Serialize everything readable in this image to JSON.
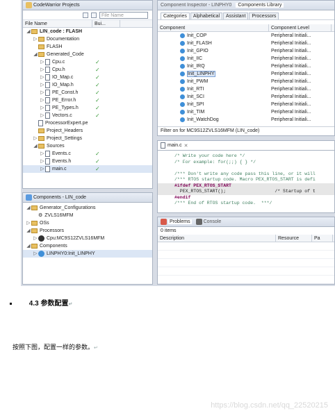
{
  "project_explorer": {
    "tab_title": "CodeWarrior Projects",
    "filter_placeholder": "File Name",
    "col_name": "File Name",
    "col_build": "Bui...",
    "rows": [
      {
        "indent": 0,
        "twisty": "◢",
        "icon": "folder",
        "label": "LIN_code : FLASH",
        "bold": true,
        "check": false
      },
      {
        "indent": 1,
        "twisty": "▷",
        "icon": "folder",
        "label": "Documentation",
        "check": false
      },
      {
        "indent": 1,
        "twisty": "",
        "icon": "folder",
        "label": "FLASH",
        "check": false
      },
      {
        "indent": 1,
        "twisty": "◢",
        "icon": "folder",
        "label": "Generated_Code",
        "check": false
      },
      {
        "indent": 2,
        "twisty": "▷",
        "icon": "file",
        "label": "Cpu.c",
        "check": true
      },
      {
        "indent": 2,
        "twisty": "▷",
        "icon": "file",
        "label": "Cpu.h",
        "check": true
      },
      {
        "indent": 2,
        "twisty": "▷",
        "icon": "file",
        "label": "IO_Map.c",
        "check": true
      },
      {
        "indent": 2,
        "twisty": "▷",
        "icon": "file",
        "label": "IO_Map.h",
        "check": true
      },
      {
        "indent": 2,
        "twisty": "▷",
        "icon": "file",
        "label": "PE_Const.h",
        "check": true
      },
      {
        "indent": 2,
        "twisty": "▷",
        "icon": "file",
        "label": "PE_Error.h",
        "check": true
      },
      {
        "indent": 2,
        "twisty": "▷",
        "icon": "file",
        "label": "PE_Types.h",
        "check": true
      },
      {
        "indent": 2,
        "twisty": "▷",
        "icon": "file",
        "label": "Vectors.c",
        "check": true
      },
      {
        "indent": 1,
        "twisty": "",
        "icon": "file",
        "label": "ProcessorExpert.pe",
        "check": false
      },
      {
        "indent": 1,
        "twisty": "",
        "icon": "folder",
        "label": "Project_Headers",
        "check": false
      },
      {
        "indent": 1,
        "twisty": "▷",
        "icon": "folder",
        "label": "Project_Settings",
        "check": false
      },
      {
        "indent": 1,
        "twisty": "◢",
        "icon": "folder",
        "label": "Sources",
        "check": false
      },
      {
        "indent": 2,
        "twisty": "▷",
        "icon": "file",
        "label": "Events.c",
        "check": true
      },
      {
        "indent": 2,
        "twisty": "▷",
        "icon": "file",
        "label": "Events.h",
        "check": true
      },
      {
        "indent": 2,
        "twisty": "▷",
        "icon": "file",
        "label": "main.c",
        "check": true,
        "selected": true
      }
    ]
  },
  "components_view": {
    "tab_title": "Components - LIN_code",
    "rows": [
      {
        "indent": 0,
        "twisty": "◢",
        "icon": "folder",
        "label": "Generator_Configurations"
      },
      {
        "indent": 1,
        "twisty": "",
        "icon": "gear",
        "label": "ZVLS16MFM"
      },
      {
        "indent": 0,
        "twisty": "▷",
        "icon": "folder",
        "label": "OSs"
      },
      {
        "indent": 0,
        "twisty": "◢",
        "icon": "folder",
        "label": "Processors"
      },
      {
        "indent": 1,
        "twisty": "▷",
        "icon": "chip",
        "label": "Cpu:MC9S12ZVLS16MFM"
      },
      {
        "indent": 0,
        "twisty": "◢",
        "icon": "folder",
        "label": "Components"
      },
      {
        "indent": 1,
        "twisty": "▷",
        "icon": "bean",
        "label": "LINPHY0:Init_LINPHY",
        "selected": true
      }
    ]
  },
  "inspector": {
    "tab1": "Component Inspector - LINPHY0",
    "tab2": "Components Library",
    "subtabs": [
      "Categories",
      "Alphabetical",
      "Assistant",
      "Processors"
    ],
    "col_component": "Component",
    "col_level": "Component Level",
    "rows": [
      {
        "name": "Init_COP",
        "level": "Peripheral Initiali..."
      },
      {
        "name": "Init_FLASH",
        "level": "Peripheral Initiali..."
      },
      {
        "name": "Init_GPIO",
        "level": "Peripheral Initiali..."
      },
      {
        "name": "Init_IIC",
        "level": "Peripheral Initiali..."
      },
      {
        "name": "Init_IRQ",
        "level": "Peripheral Initiali..."
      },
      {
        "name": "Init_LINPHY",
        "level": "Peripheral Initiali...",
        "selected": true
      },
      {
        "name": "Init_PWM",
        "level": "Peripheral Initiali..."
      },
      {
        "name": "Init_RTI",
        "level": "Peripheral Initiali..."
      },
      {
        "name": "Init_SCI",
        "level": "Peripheral Initiali..."
      },
      {
        "name": "Init_SPI",
        "level": "Peripheral Initiali..."
      },
      {
        "name": "Init_TIM",
        "level": "Peripheral Initiali..."
      },
      {
        "name": "Init_WatchDog",
        "level": "Peripheral Initiali..."
      }
    ],
    "filter_text": "Filter on for MC9S12ZVLS16MFM (LIN_code)"
  },
  "editor": {
    "tab": "main.c",
    "lines": [
      {
        "cls": "cm",
        "text": "/* Write your code here */"
      },
      {
        "cls": "cm",
        "text": "/* For example: for(;;) { } */"
      },
      {
        "cls": "",
        "text": ""
      },
      {
        "cls": "cm",
        "text": "/*** Don't write any code pass this line, or it will"
      },
      {
        "cls": "cm",
        "text": "/*** RTOS startup code. Macro PEX_RTOS_START is defi"
      },
      {
        "cls": "pp hl",
        "text": "#ifdef PEX_RTOS_START"
      },
      {
        "cls": "hl",
        "text": "  PEX_RTOS_START();                  /* Startup of t"
      },
      {
        "cls": "pp",
        "text": "#endif"
      },
      {
        "cls": "cm",
        "text": "/*** End of RTOS startup code.  ***/"
      }
    ]
  },
  "problems": {
    "tab": "Problems",
    "tab2": "Console",
    "count": "0 items",
    "cols": [
      "Description",
      "Resource",
      "Pa"
    ]
  },
  "doc": {
    "heading_num": "4.3",
    "heading_text": "参数配置",
    "paragraph": "按照下图，配置一样的参数。",
    "watermark": "https://blog.csdn.net/qq_22520215"
  }
}
